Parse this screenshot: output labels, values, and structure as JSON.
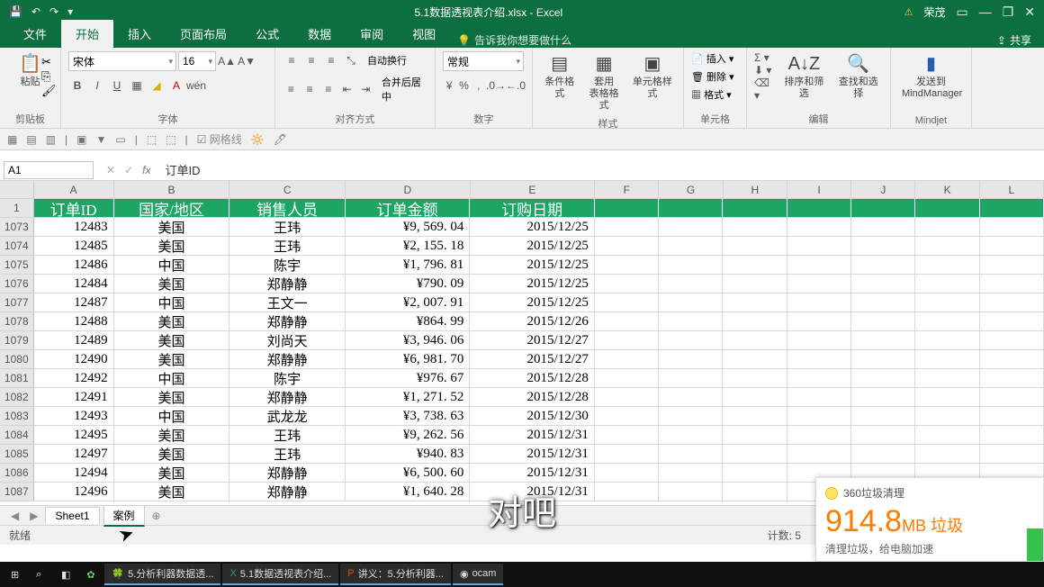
{
  "titlebar": {
    "filename": "5.1数据透视表介绍.xlsx - Excel",
    "user": "荣茂"
  },
  "tabs": {
    "file": "文件",
    "home": "开始",
    "insert": "插入",
    "layout": "页面布局",
    "formula": "公式",
    "data": "数据",
    "review": "审阅",
    "view": "视图",
    "tell": "告诉我你想要做什么",
    "share": "共享"
  },
  "ribbon": {
    "clipboard": {
      "paste": "粘贴",
      "label": "剪贴板"
    },
    "font": {
      "name": "宋体",
      "size": "16",
      "label": "字体"
    },
    "align": {
      "wrap": "自动换行",
      "merge": "合并后居中",
      "label": "对齐方式"
    },
    "number": {
      "fmt": "常规",
      "label": "数字"
    },
    "styles": {
      "cf": "条件格式",
      "tbl": "套用\n表格格式",
      "cell": "单元格样式",
      "label": "样式"
    },
    "cells": {
      "ins": "插入",
      "del": "删除",
      "fmt": "格式",
      "label": "单元格"
    },
    "edit": {
      "sort": "排序和筛选",
      "find": "查找和选择",
      "label": "编辑"
    },
    "mindjet": {
      "send": "发送到\nMindManager",
      "label": "Mindjet"
    }
  },
  "toolbar2": {
    "grid": "网格线"
  },
  "namebox": "A1",
  "formula": "订单ID",
  "columns": [
    "A",
    "B",
    "C",
    "D",
    "E",
    "F",
    "G",
    "H",
    "I",
    "J",
    "K",
    "L"
  ],
  "headerRow": "1",
  "headers": [
    "订单ID",
    "国家/地区",
    "销售人员",
    "订单金额",
    "订购日期"
  ],
  "rows": [
    {
      "n": "1073",
      "id": "12483",
      "c": "美国",
      "p": "王玮",
      "amt": "¥9, 569. 04",
      "d": "2015/12/25"
    },
    {
      "n": "1074",
      "id": "12485",
      "c": "美国",
      "p": "王玮",
      "amt": "¥2, 155. 18",
      "d": "2015/12/25"
    },
    {
      "n": "1075",
      "id": "12486",
      "c": "中国",
      "p": "陈宇",
      "amt": "¥1, 796. 81",
      "d": "2015/12/25"
    },
    {
      "n": "1076",
      "id": "12484",
      "c": "美国",
      "p": "郑静静",
      "amt": "¥790. 09",
      "d": "2015/12/25"
    },
    {
      "n": "1077",
      "id": "12487",
      "c": "中国",
      "p": "王文一",
      "amt": "¥2, 007. 91",
      "d": "2015/12/25"
    },
    {
      "n": "1078",
      "id": "12488",
      "c": "美国",
      "p": "郑静静",
      "amt": "¥864. 99",
      "d": "2015/12/26"
    },
    {
      "n": "1079",
      "id": "12489",
      "c": "美国",
      "p": "刘尚天",
      "amt": "¥3, 946. 06",
      "d": "2015/12/27"
    },
    {
      "n": "1080",
      "id": "12490",
      "c": "美国",
      "p": "郑静静",
      "amt": "¥6, 981. 70",
      "d": "2015/12/27"
    },
    {
      "n": "1081",
      "id": "12492",
      "c": "中国",
      "p": "陈宇",
      "amt": "¥976. 67",
      "d": "2015/12/28"
    },
    {
      "n": "1082",
      "id": "12491",
      "c": "美国",
      "p": "郑静静",
      "amt": "¥1, 271. 52",
      "d": "2015/12/28"
    },
    {
      "n": "1083",
      "id": "12493",
      "c": "中国",
      "p": "武龙龙",
      "amt": "¥3, 738. 63",
      "d": "2015/12/30"
    },
    {
      "n": "1084",
      "id": "12495",
      "c": "美国",
      "p": "王玮",
      "amt": "¥9, 262. 56",
      "d": "2015/12/31"
    },
    {
      "n": "1085",
      "id": "12497",
      "c": "美国",
      "p": "王玮",
      "amt": "¥940. 83",
      "d": "2015/12/31"
    },
    {
      "n": "1086",
      "id": "12494",
      "c": "美国",
      "p": "郑静静",
      "amt": "¥6, 500. 60",
      "d": "2015/12/31"
    },
    {
      "n": "1087",
      "id": "12496",
      "c": "美国",
      "p": "郑静静",
      "amt": "¥1, 640. 28",
      "d": "2015/12/31"
    }
  ],
  "sheets": {
    "s1": "Sheet1",
    "s2": "案例"
  },
  "status": {
    "ready": "就绪",
    "count": "计数: 5"
  },
  "subtitle": "对吧",
  "popup": {
    "title": "360垃圾清理",
    "big": "914.8",
    "unit": "MB 垃圾",
    "sub": "清理垃圾，给电脑加速"
  },
  "taskbar": {
    "t1": "5.分析利器数据透...",
    "t2": "5.1数据透视表介绍...",
    "t3": "讲义：5.分析利器...",
    "t4": "ocam"
  }
}
